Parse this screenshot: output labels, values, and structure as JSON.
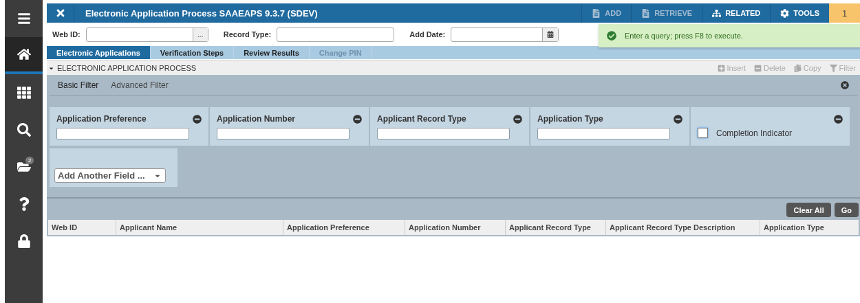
{
  "sidebar": {
    "items": [
      {
        "selected": false
      },
      {
        "selected": true
      },
      {
        "selected": false
      },
      {
        "selected": false
      },
      {
        "selected": false,
        "badge": "2"
      },
      {
        "selected": false
      },
      {
        "selected": false
      }
    ]
  },
  "header": {
    "title": "Electronic Application Process SAAEAPS 9.3.7 (SDEV)",
    "actions": [
      {
        "label": "ADD",
        "disabled": true
      },
      {
        "label": "RETRIEVE",
        "disabled": true
      },
      {
        "label": "RELATED",
        "disabled": false
      },
      {
        "label": "TOOLS",
        "disabled": false
      }
    ],
    "notification_count": "1"
  },
  "key_block": [
    {
      "label": "Web ID:",
      "kind": "lookup",
      "button": "..."
    },
    {
      "label": "Record Type:",
      "kind": "text"
    },
    {
      "label": "Add Date:",
      "kind": "date"
    }
  ],
  "message": "Enter a query; press F8 to execute.",
  "tabs": [
    {
      "label": "Electronic Applications",
      "selected": true,
      "disabled": false
    },
    {
      "label": "Verification Steps",
      "selected": false,
      "disabled": false
    },
    {
      "label": "Review Results",
      "selected": false,
      "disabled": false
    },
    {
      "label": "Change PIN",
      "selected": false,
      "disabled": true
    }
  ],
  "section": {
    "title": "ELECTRONIC APPLICATION PROCESS",
    "expanded": true,
    "tools": [
      {
        "label": "Insert",
        "disabled": true
      },
      {
        "label": "Delete",
        "disabled": true
      },
      {
        "label": "Copy",
        "disabled": true
      },
      {
        "label": "Filter",
        "disabled": true
      }
    ]
  },
  "filter": {
    "modes": [
      {
        "label": "Basic Filter",
        "selected": true
      },
      {
        "label": "Advanced Filter",
        "selected": false
      }
    ],
    "fields": [
      {
        "label": "Application Preference",
        "kind": "text"
      },
      {
        "label": "Application Number",
        "kind": "text"
      },
      {
        "label": "Applicant Record Type",
        "kind": "text"
      },
      {
        "label": "Application Type",
        "kind": "text"
      },
      {
        "label": "Completion Indicator",
        "kind": "checkbox",
        "checked": false
      }
    ],
    "add_field": "Add Another Field ...",
    "buttons": [
      "Clear All",
      "Go"
    ]
  },
  "table": {
    "columns": [
      "Web ID",
      "Applicant Name",
      "Application Preference",
      "Application Number",
      "Applicant Record Type",
      "Applicant Record Type Description",
      "Application Type"
    ]
  }
}
